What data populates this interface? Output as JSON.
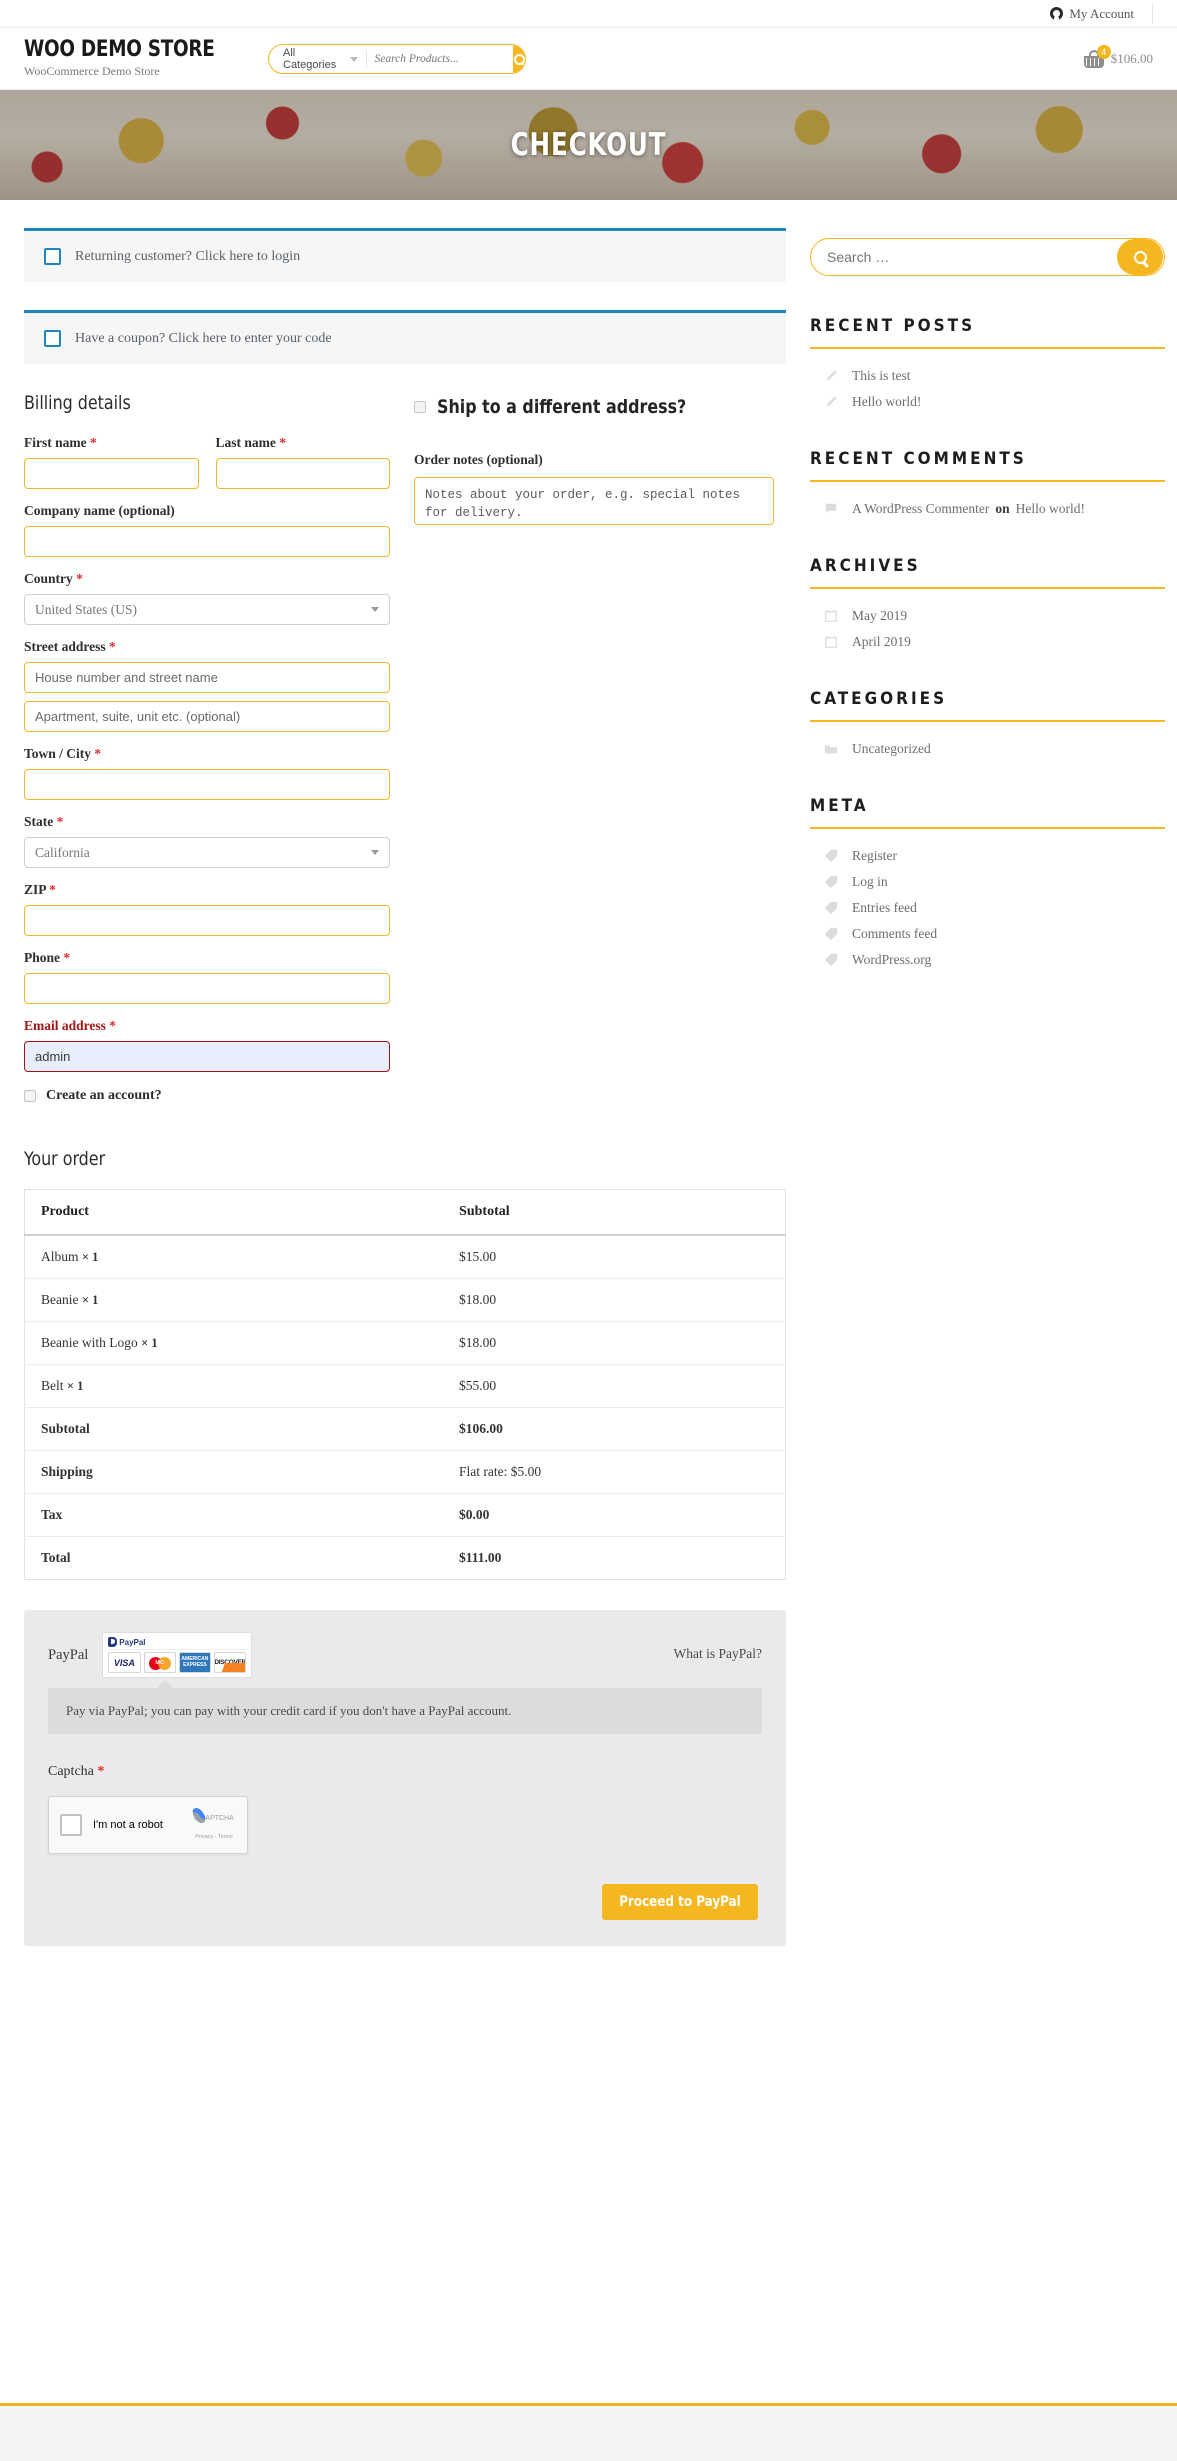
{
  "topbar": {
    "account_label": "My Account"
  },
  "header": {
    "brand_title": "WOO DEMO STORE",
    "brand_subtitle": "WooCommerce Demo Store",
    "category_label": "All Categories",
    "search_placeholder": "Search Products...",
    "cart_count": "4",
    "cart_total": "$106.00"
  },
  "hero": {
    "title": "CHECKOUT"
  },
  "notices": [
    {
      "text": "Returning customer? Click here to login"
    },
    {
      "text": "Have a coupon? Click here to enter your code"
    }
  ],
  "billing": {
    "heading": "Billing details",
    "first_name_label": "First name",
    "last_name_label": "Last name",
    "company_label": "Company name (optional)",
    "country_label": "Country",
    "country_value": "United States (US)",
    "street_label": "Street address",
    "street_placeholder": "House number and street name",
    "street2_placeholder": "Apartment, suite, unit etc. (optional)",
    "city_label": "Town / City",
    "state_label": "State",
    "state_value": "California",
    "zip_label": "ZIP",
    "phone_label": "Phone",
    "email_label": "Email address",
    "email_value": "admin",
    "create_account_label": "Create an account?",
    "required_mark": "*"
  },
  "shipping": {
    "ship_different_label": "Ship to a different address?",
    "notes_label": "Order notes (optional)",
    "notes_placeholder": "Notes about your order, e.g. special notes for delivery."
  },
  "order": {
    "heading": "Your order",
    "col_product": "Product",
    "col_subtotal": "Subtotal",
    "items": [
      {
        "name": "Album",
        "qty": "× 1",
        "price": "$15.00"
      },
      {
        "name": "Beanie",
        "qty": "× 1",
        "price": "$18.00"
      },
      {
        "name": "Beanie with Logo",
        "qty": "× 1",
        "price": "$18.00"
      },
      {
        "name": "Belt",
        "qty": "× 1",
        "price": "$55.00"
      }
    ],
    "totals": [
      {
        "label": "Subtotal",
        "value": "$106.00"
      },
      {
        "label": "Shipping",
        "value": "Flat rate: $5.00"
      },
      {
        "label": "Tax",
        "value": "$0.00"
      },
      {
        "label": "Total",
        "value": "$111.00"
      }
    ]
  },
  "payment": {
    "method_label": "PayPal",
    "what_is_paypal": "What is PayPal?",
    "description": "Pay via PayPal; you can pay with your credit card if you don't have a PayPal account.",
    "paypal_logo_text": "PayPal",
    "cards": [
      "VISA",
      "MasterCard",
      "AMERICAN EXPRESS",
      "DISCOVER"
    ],
    "captcha_label": "Captcha",
    "captcha_required": "*",
    "recaptcha_text": "I'm not a robot",
    "recaptcha_brand": "reCAPTCHA",
    "recaptcha_legal": "Privacy - Terms",
    "submit_label": "Proceed to PayPal"
  },
  "sidebar": {
    "search_placeholder": "Search …",
    "widgets": [
      {
        "title": "RECENT POSTS",
        "icon": "pencil-icon",
        "items": [
          {
            "text": "This is test"
          },
          {
            "text": "Hello world!"
          }
        ]
      },
      {
        "title": "RECENT COMMENTS",
        "icon": "comment-icon",
        "items": [
          {
            "author": "A WordPress Commenter",
            "on": "on",
            "post": "Hello world!"
          }
        ]
      },
      {
        "title": "ARCHIVES",
        "icon": "calendar-icon",
        "items": [
          {
            "text": "May 2019"
          },
          {
            "text": "April 2019"
          }
        ]
      },
      {
        "title": "CATEGORIES",
        "icon": "folder-icon",
        "items": [
          {
            "text": "Uncategorized"
          }
        ]
      },
      {
        "title": "META",
        "icon": "tag-icon",
        "items": [
          {
            "text": "Register"
          },
          {
            "text": "Log in"
          },
          {
            "text": "Entries feed"
          },
          {
            "text": "Comments feed"
          },
          {
            "text": "WordPress.org"
          }
        ]
      }
    ]
  },
  "colors": {
    "accent": "#F5B720",
    "notice_border": "#1e85be",
    "required": "#e02b2b",
    "error": "#a31515"
  }
}
